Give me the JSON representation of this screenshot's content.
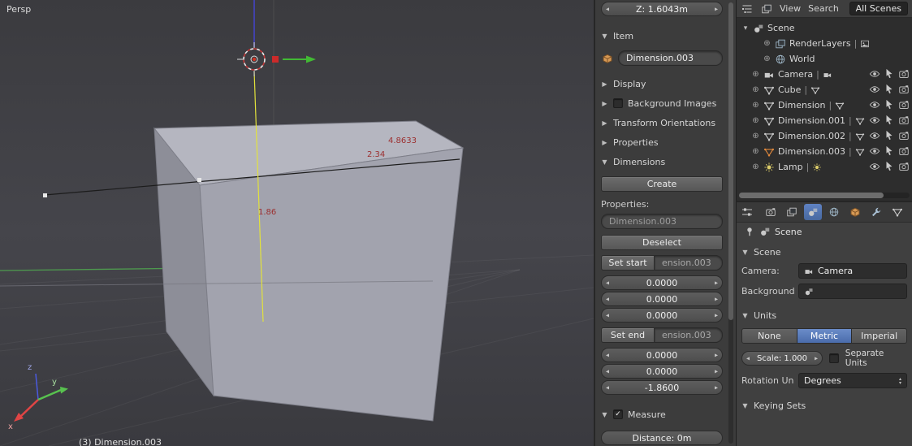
{
  "viewport": {
    "view_label": "Persp",
    "active_object_label": "(3) Dimension.003",
    "dimension_labels": [
      "4.8633",
      "2.34",
      "1.86"
    ],
    "axis_gizmo": {
      "x": "x",
      "y": "y",
      "z": "z"
    }
  },
  "tool_shelf": {
    "transform": {
      "z_value": "Z: 1.6043m"
    },
    "item_panel": {
      "title": "Item",
      "name_value": "Dimension.003"
    },
    "collapsed_panels": {
      "display": "Display",
      "background_images": "Background Images",
      "transform_orientations": "Transform Orientations",
      "properties": "Properties"
    },
    "dimensions_panel": {
      "title": "Dimensions",
      "create": "Create",
      "properties_label": "Properties:",
      "name_value": "Dimension.003",
      "deselect": "Deselect",
      "set_start": "Set start",
      "start_object": "ension.003",
      "start_coords": [
        "0.0000",
        "0.0000",
        "0.0000"
      ],
      "set_end": "Set end",
      "end_object": "ension.003",
      "end_coords": [
        "0.0000",
        "0.0000",
        "-1.8600"
      ]
    },
    "measure_panel": {
      "title": "Measure",
      "distance": "Distance: 0m"
    }
  },
  "outliner": {
    "menus": {
      "view": "View",
      "search": "Search"
    },
    "scenes_filter": "All Scenes",
    "rows": [
      {
        "label": "Scene",
        "icon": "scene"
      },
      {
        "label": "RenderLayers",
        "icon": "render-layers"
      },
      {
        "label": "World",
        "icon": "world"
      },
      {
        "label": "Camera",
        "icon": "camera"
      },
      {
        "label": "Cube",
        "icon": "mesh"
      },
      {
        "label": "Dimension",
        "icon": "mesh"
      },
      {
        "label": "Dimension.001",
        "icon": "mesh"
      },
      {
        "label": "Dimension.002",
        "icon": "mesh"
      },
      {
        "label": "Dimension.003",
        "icon": "mesh",
        "active": true
      },
      {
        "label": "Lamp",
        "icon": "lamp"
      }
    ]
  },
  "properties_editor": {
    "tabs": [
      {
        "icon": "render"
      },
      {
        "icon": "render-layers"
      },
      {
        "icon": "scene",
        "selected": true
      },
      {
        "icon": "world"
      },
      {
        "icon": "object"
      },
      {
        "icon": "modifiers"
      },
      {
        "icon": "data"
      }
    ],
    "breadcrumb": "Scene",
    "scene_panel": {
      "title": "Scene",
      "camera_label": "Camera:",
      "camera_value": "Camera",
      "background_label": "Background"
    },
    "units_panel": {
      "title": "Units",
      "system_options": [
        "None",
        "Metric",
        "Imperial"
      ],
      "selected_system": "Metric",
      "scale": "Scale: 1.000",
      "separate_units": "Separate Units",
      "rotation_label": "Rotation Un",
      "rotation_value": "Degrees"
    },
    "keying_sets_panel": {
      "title": "Keying Sets"
    }
  },
  "colors": {
    "selection_blue": "#4f74b8",
    "dimension_text_red": "#9c2f2f",
    "axis_x_red": "#e04545",
    "axis_y_green": "#58c24f",
    "axis_z_blue": "#4a5ae0",
    "active_object_orange": "#e0883c",
    "cube_top": "#b5b6c0",
    "cube_front": "#a2a3ae",
    "cube_left": "#8d8e98"
  }
}
